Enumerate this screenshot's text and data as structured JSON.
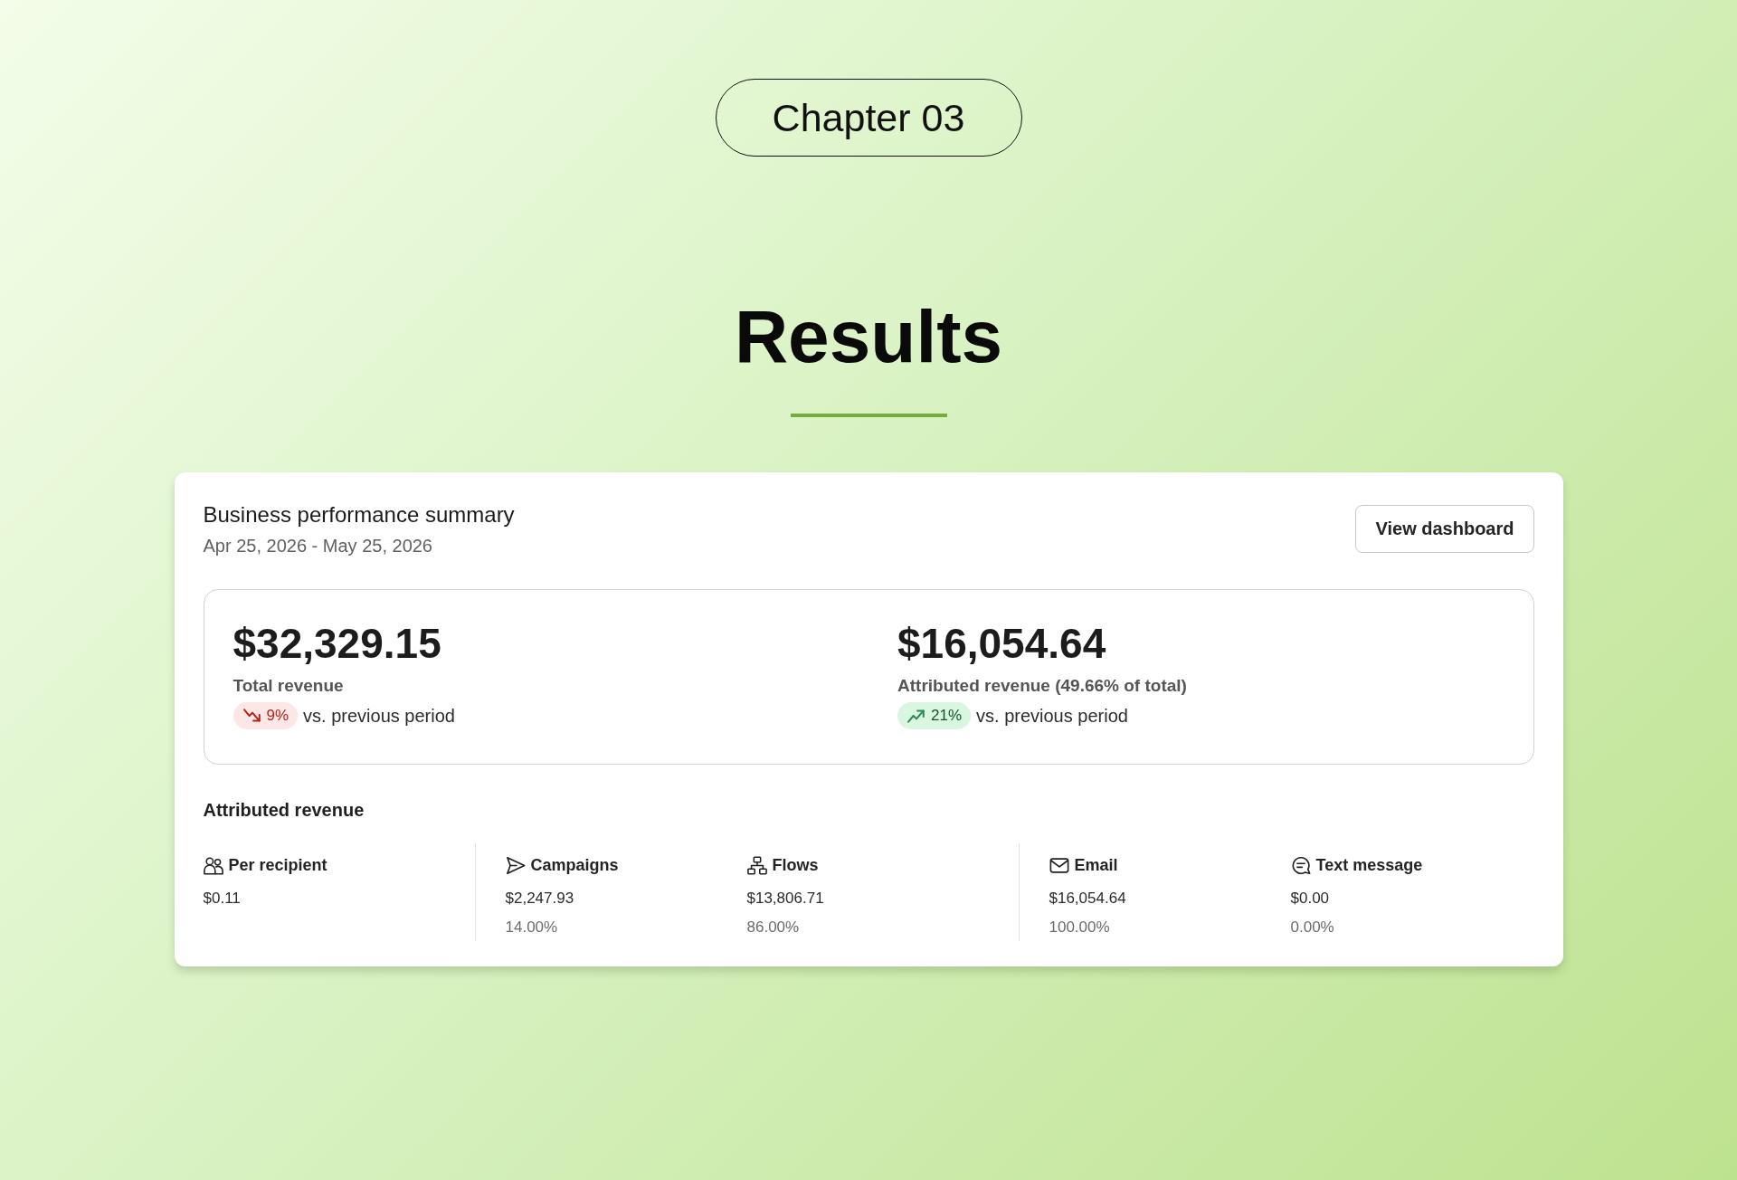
{
  "chapter_badge": "Chapter 03",
  "title": "Results",
  "summary": {
    "title": "Business performance summary",
    "date_range": "Apr 25, 2026 - May 25, 2026",
    "button": "View dashboard",
    "metrics": [
      {
        "value": "$32,329.15",
        "label": "Total revenue",
        "change": {
          "kind": "down",
          "text": "9%"
        },
        "comparison": "vs. previous period"
      },
      {
        "value": "$16,054.64",
        "label": "Attributed revenue (49.66% of total)",
        "change": {
          "kind": "up",
          "text": "21%"
        },
        "comparison": "vs. previous period"
      }
    ],
    "attributed_revenue": {
      "heading": "Attributed revenue",
      "groups": [
        {
          "items": [
            {
              "kind": "recipient",
              "label": "Per recipient",
              "value": "$0.11"
            }
          ]
        },
        {
          "items": [
            {
              "kind": "campaign",
              "label": "Campaigns",
              "value": "$2,247.93",
              "share": "14.00%"
            },
            {
              "kind": "flow",
              "label": "Flows",
              "value": "$13,806.71",
              "share": "86.00%"
            }
          ]
        },
        {
          "items": [
            {
              "kind": "email",
              "label": "Email",
              "value": "$16,054.64",
              "share": "100.00%"
            },
            {
              "kind": "sms",
              "label": "Text message",
              "value": "$0.00",
              "share": "0.00%"
            }
          ]
        }
      ]
    }
  }
}
